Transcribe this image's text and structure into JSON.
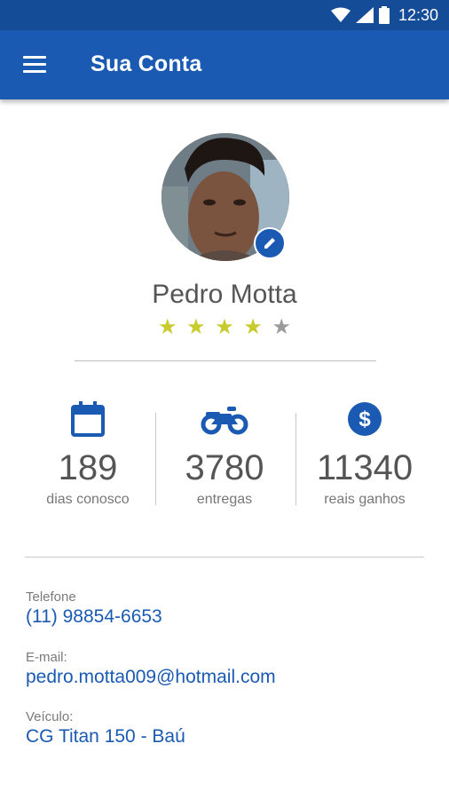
{
  "status_bar": {
    "time": "12:30"
  },
  "header": {
    "title": "Sua Conta"
  },
  "profile": {
    "name": "Pedro Motta",
    "rating": 4,
    "rating_max": 5
  },
  "stats": [
    {
      "icon": "calendar-icon",
      "value": "189",
      "label": "dias conosco"
    },
    {
      "icon": "motorcycle-icon",
      "value": "3780",
      "label": "entregas"
    },
    {
      "icon": "dollar-icon",
      "value": "11340",
      "label": "reais ganhos"
    }
  ],
  "contact": {
    "phone_label": "Telefone",
    "phone": "(11) 98854-6653",
    "email_label": "E-mail:",
    "email": "pedro.motta009@hotmail.com",
    "vehicle_label": "Veículo:",
    "vehicle": "CG Titan 150 - Baú"
  },
  "colors": {
    "primary": "#1a5ab2",
    "status_bar": "#154c98",
    "star_on": "#c8cb2d",
    "star_off": "#9a9a9a"
  }
}
